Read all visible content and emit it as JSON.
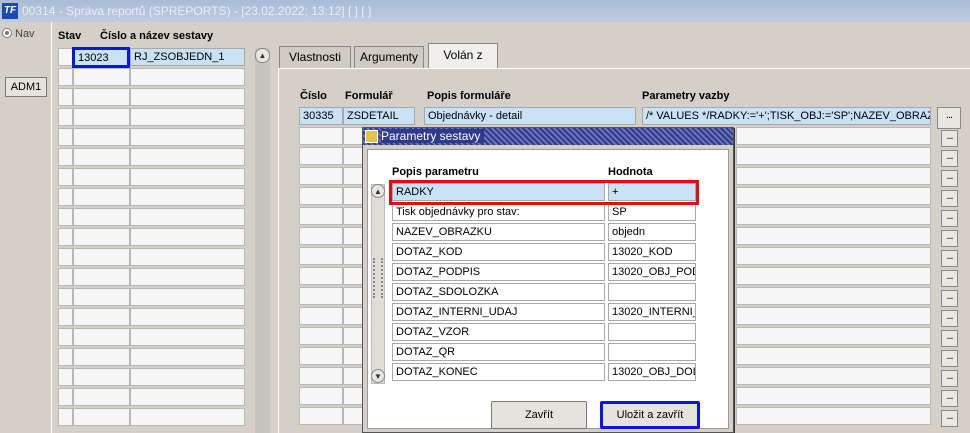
{
  "window": {
    "title": "00314 - Správa reportů (SPREPORTS) - [23.02.2022; 13:12]  [ ]  [ ]"
  },
  "left": {
    "nav_label": "Nav",
    "adm_button": "ADM1"
  },
  "grid": {
    "col_stav": "Stav",
    "col_cislo": "Číslo a název sestavy",
    "row": {
      "id": "13023",
      "name": "RJ_ZSOBJEDN_1"
    }
  },
  "tabs": [
    {
      "label": "Vlastnosti"
    },
    {
      "label": "Argumenty"
    },
    {
      "label": "Volán z"
    }
  ],
  "called_from": {
    "headers": {
      "cislo": "Číslo",
      "formular": "Formulář",
      "popis": "Popis formuláře",
      "parametry": "Parametry vazby"
    },
    "row": {
      "cislo": "30335",
      "formular": "ZSDETAIL",
      "popis": "Objednávky - detail",
      "parametry": "/* VALUES */RADKY:='+';TISK_OBJ:='SP';NAZEV_OBRAZK"
    },
    "dots_label": "..."
  },
  "dialog": {
    "title": "Parametry sestavy",
    "col_popis": "Popis parametru",
    "col_hodnota": "Hodnota",
    "params": [
      {
        "name": "RADKY",
        "value": "+"
      },
      {
        "name": "Tisk objednávky pro stav:",
        "value": "SP"
      },
      {
        "name": "NAZEV_OBRAZKU",
        "value": "objedn"
      },
      {
        "name": "DOTAZ_KOD",
        "value": "13020_KOD"
      },
      {
        "name": "DOTAZ_PODPIS",
        "value": "13020_OBJ_PODI"
      },
      {
        "name": "DOTAZ_SDOLOZKA",
        "value": ""
      },
      {
        "name": "DOTAZ_INTERNI_UDAJ",
        "value": "13020_INTERNI_U"
      },
      {
        "name": "DOTAZ_VZOR",
        "value": ""
      },
      {
        "name": "DOTAZ_QR",
        "value": ""
      },
      {
        "name": "DOTAZ_KONEC",
        "value": "13020_OBJ_DOLO"
      }
    ],
    "close_button": "Zavřít",
    "save_close_button": "Uložit a zavřít"
  }
}
